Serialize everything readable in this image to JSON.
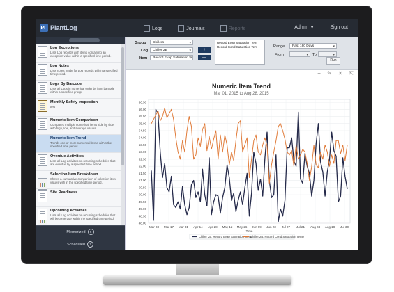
{
  "app": {
    "logo_letter": "PL",
    "name": "PlantLog",
    "nav": [
      {
        "label": "Logs",
        "active": false
      },
      {
        "label": "Journals",
        "active": false
      },
      {
        "label": "Reports",
        "active": true
      }
    ],
    "user_menu": "Admin ▼",
    "signout": "Sign out"
  },
  "sidebar": {
    "items": [
      {
        "title": "Log Exceptions",
        "desc": "Lists Log records with items containing an exception value within a specified time period.",
        "icon": "document-icon"
      },
      {
        "title": "Log Notes",
        "desc": "Lists notes made for Log records within a specified time period.",
        "icon": "document-icon"
      },
      {
        "title": "Logs By Barcode",
        "desc": "Lists all Logs in numerical order by item barcode within a specified group.",
        "icon": "document-icon"
      },
      {
        "title": "Monthly Safety Inspection",
        "desc": "test",
        "icon": "clipboard-icon"
      },
      {
        "title": "Numeric Item Comparison",
        "desc": "Compares multiple numerical items side by side with high, low, and average values.",
        "icon": "document-icon"
      },
      {
        "title": "Numeric Item Trend",
        "desc": "Trends one or more numerical items within the specified time period.",
        "icon": "chart-icon"
      },
      {
        "title": "Overdue Activities",
        "desc": "Lists all Log activities on recurring schedules that are overdue by a specified time period.",
        "icon": "document-icon"
      },
      {
        "title": "Selection Item Breakdown",
        "desc": "Shows a cumulative comparison of selection item values with in the specified time period.",
        "icon": "chart-icon"
      },
      {
        "title": "Site Readiness",
        "desc": "",
        "icon": "document-icon"
      },
      {
        "title": "Upcoming Activities",
        "desc": "Lists all Log activities on recurring schedules that will become due within the specified time period.",
        "icon": "document-icon"
      }
    ],
    "selected_index": 5,
    "footer": [
      {
        "label": "Memorized",
        "count": "5"
      },
      {
        "label": "Scheduled",
        "count": "1"
      }
    ]
  },
  "filters": {
    "group_label": "Group",
    "group_value": "Chillers",
    "log_label": "Log",
    "log_value": "Chiller 2B",
    "item_label": "Item",
    "item_value": "Record Evap Saturation Temp",
    "add_button": "+",
    "remove_button": "—",
    "selected_items": [
      "Record Evap Saturation Tem",
      "Record Cond Saturation Tem"
    ],
    "range_label": "Range",
    "range_value": "Past 180 Days",
    "from_label": "From",
    "to_label": "To",
    "run_button": "Run"
  },
  "toolbar": {
    "icons": [
      "plus-icon",
      "edit-icon",
      "delete-icon",
      "export-icon"
    ],
    "glyphs": [
      "+",
      "✎",
      "✕",
      "⇱"
    ]
  },
  "chart_data": {
    "type": "line",
    "title": "Numeric Item Trend",
    "subtitle": "Mar 01, 2015 to Aug 28, 2015",
    "xlabel": "Time",
    "ylabel": "",
    "x_ticks": [
      "Mar 03",
      "Mar 17",
      "Mar 31",
      "Apr 14",
      "Apr 28",
      "May 12",
      "May 26",
      "Jun 09",
      "Jun 23",
      "Jul 07",
      "Jul 21",
      "Aug 04",
      "Aug 18",
      "Jul 30"
    ],
    "y_ticks": [
      48.0,
      48.5,
      49.0,
      49.5,
      50.0,
      50.5,
      51.0,
      51.5,
      52.0,
      52.5,
      53.0,
      53.5,
      54.0,
      54.5,
      55.0,
      55.5,
      56.0,
      56.5
    ],
    "ylim": [
      48.0,
      56.7
    ],
    "grid": true,
    "legend": "bottom",
    "series": [
      {
        "name": "Chiller 2B: Record Evap Saturation Temp",
        "color": "#252a4a",
        "values": [
          51.7,
          48.2,
          56.0,
          55.7,
          53.0,
          51.2,
          52.2,
          50.5,
          50.2,
          51.3,
          49.3,
          49.1,
          49.5,
          49.0,
          50.6,
          49.3,
          48.6,
          49.1,
          50.7,
          51.0,
          49.8,
          50.2,
          49.5,
          51.8,
          50.0,
          49.2,
          52.6,
          48.6,
          49.5,
          50.0,
          49.9,
          48.7,
          49.8,
          50.5,
          52.1,
          51.2,
          49.6,
          50.1,
          48.8,
          49.6,
          50.2,
          49.3,
          50.5,
          51.5,
          48.5,
          50.1,
          53.0,
          52.2,
          50.3,
          51.1,
          49.9,
          52.6,
          54.4,
          51.0,
          49.8,
          50.0,
          52.8,
          48.1,
          49.0,
          48.5,
          49.6,
          53.3,
          53.3,
          54.0,
          52.4,
          52.0,
          55.8,
          51.1,
          50.8,
          52.9,
          52.0,
          51.5,
          49.9,
          51.0,
          53.6,
          55.0,
          52.3,
          51.6,
          49.9,
          51.6,
          52.5,
          54.4,
          53.1,
          52.7,
          49.5,
          49.9,
          52.6,
          51.3,
          50.4
        ]
      },
      {
        "name": "Chiller 2B: Record Cond Saturation Temp",
        "color": "#e07b39",
        "values": [
          55.0,
          55.3,
          55.6,
          55.9,
          55.2,
          55.5,
          56.1,
          55.4,
          55.7,
          56.0,
          55.3,
          54.0,
          53.0,
          52.5,
          53.8,
          53.0,
          54.5,
          55.5,
          54.8,
          52.5,
          52.8,
          54.0,
          53.4,
          54.6,
          55.0,
          53.1,
          54.1,
          53.2,
          53.9,
          54.5,
          52.5,
          54.2,
          53.0,
          54.2,
          53.5,
          52.1,
          53.0,
          52.4,
          53.8,
          55.0,
          55.2,
          53.0,
          53.5,
          54.0,
          51.2,
          52.5,
          53.8,
          54.2,
          53.0,
          52.8,
          53.5,
          54.0,
          53.4,
          50.8,
          52.1,
          53.0,
          53.8,
          54.8,
          55.0,
          54.5,
          53.9,
          53.0,
          52.8,
          53.1,
          52.0,
          53.5,
          52.5,
          52.8,
          53.2,
          53.0,
          52.2,
          51.0,
          52.0,
          53.5,
          52.1,
          51.9,
          53.0,
          52.5,
          53.5,
          53.0,
          52.0,
          52.8,
          52.2,
          53.8,
          53.8,
          52.9,
          53.5,
          52.4,
          53.5
        ]
      }
    ]
  }
}
